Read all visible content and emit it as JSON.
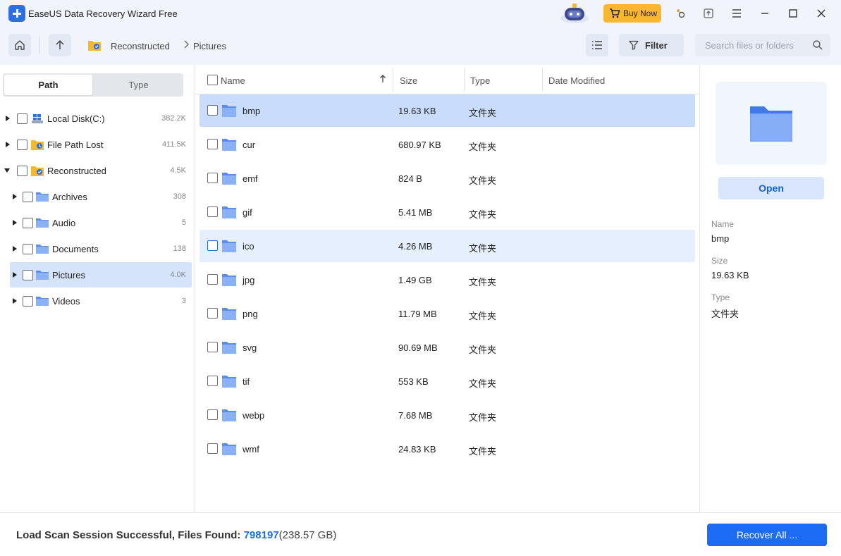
{
  "titlebar": {
    "app_title": "EaseUS Data Recovery Wizard Free",
    "buy_now_label": "Buy Now"
  },
  "toolbar": {
    "breadcrumb": [
      "Reconstructed",
      "Pictures"
    ],
    "filter_label": "Filter",
    "search_placeholder": "Search files or folders",
    "search_value": ""
  },
  "left_panel": {
    "tabs": [
      {
        "label": "Path",
        "active": true
      },
      {
        "label": "Type",
        "active": false
      }
    ],
    "tree": [
      {
        "label": "Local Disk(C:)",
        "count": "382.2K",
        "expanded": false
      },
      {
        "label": "File Path Lost",
        "count": "411.5K",
        "expanded": false
      },
      {
        "label": "Reconstructed",
        "count": "4.5K",
        "expanded": true
      },
      {
        "label": "Archives",
        "count": "308",
        "expanded": false
      },
      {
        "label": "Audio",
        "count": "5",
        "expanded": false
      },
      {
        "label": "Documents",
        "count": "138",
        "expanded": false
      },
      {
        "label": "Pictures",
        "count": "4.0K",
        "expanded": false,
        "selected": true
      },
      {
        "label": "Videos",
        "count": "3",
        "expanded": false
      }
    ]
  },
  "table": {
    "columns": [
      "Name",
      "Size",
      "Type",
      "Date Modified"
    ],
    "rows": [
      {
        "name": "bmp",
        "size": "19.63 KB",
        "type": "文件夹",
        "date": ""
      },
      {
        "name": "cur",
        "size": "680.97 KB",
        "type": "文件夹",
        "date": ""
      },
      {
        "name": "emf",
        "size": "824 B",
        "type": "文件夹",
        "date": ""
      },
      {
        "name": "gif",
        "size": "5.41 MB",
        "type": "文件夹",
        "date": ""
      },
      {
        "name": "ico",
        "size": "4.26 MB",
        "type": "文件夹",
        "date": ""
      },
      {
        "name": "jpg",
        "size": "1.49 GB",
        "type": "文件夹",
        "date": ""
      },
      {
        "name": "png",
        "size": "11.79 MB",
        "type": "文件夹",
        "date": ""
      },
      {
        "name": "svg",
        "size": "90.69 MB",
        "type": "文件夹",
        "date": ""
      },
      {
        "name": "tif",
        "size": "553 KB",
        "type": "文件夹",
        "date": ""
      },
      {
        "name": "webp",
        "size": "7.68 MB",
        "type": "文件夹",
        "date": ""
      },
      {
        "name": "wmf",
        "size": "24.83 KB",
        "type": "文件夹",
        "date": ""
      }
    ]
  },
  "details": {
    "open_label": "Open",
    "name_label": "Name",
    "name_value": "bmp",
    "size_label": "Size",
    "size_value": "19.63 KB",
    "type_label": "Type",
    "type_value": "文件夹"
  },
  "status": {
    "prefix": "Load Scan Session Successful, Files Found: ",
    "files_found": "798197",
    "total_size": "(238.57 GB)",
    "recover_label": "Recover All ..."
  },
  "colors": {
    "accent": "#1d6cf5",
    "buy_now": "#f9b731",
    "selected_row": "#c9dcfb",
    "hover_row": "#e6effd",
    "tree_selected": "#d6e4fb"
  }
}
